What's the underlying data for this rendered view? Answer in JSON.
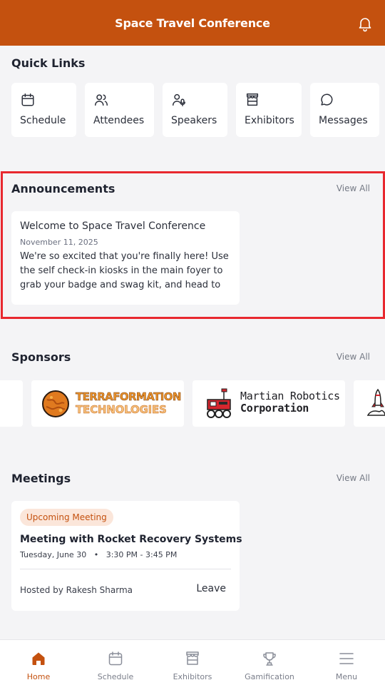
{
  "header": {
    "title": "Space Travel Conference",
    "bell_icon": "bell-icon"
  },
  "quick_links": {
    "title": "Quick Links",
    "items": [
      {
        "label": "Schedule",
        "icon": "calendar-icon"
      },
      {
        "label": "Attendees",
        "icon": "users-icon"
      },
      {
        "label": "Speakers",
        "icon": "speaker-icon"
      },
      {
        "label": "Exhibitors",
        "icon": "booth-icon"
      },
      {
        "label": "Messages",
        "icon": "chat-bubble-icon"
      }
    ]
  },
  "announcements": {
    "title": "Announcements",
    "view_all": "View All",
    "items": [
      {
        "title": "Welcome to Space Travel Conference",
        "date": "November 11, 2025",
        "body": "We're so excited that you're finally here! Use the self check-in kiosks in the main foyer to grab your badge and swag kit, and head to the main stage for the opening keynote."
      }
    ]
  },
  "sponsors": {
    "title": "Sponsors",
    "view_all": "View All",
    "items": [
      {
        "line1": "TERRAFORMATION",
        "line2": "TECHNOLOGIES"
      },
      {
        "line1": "Martian Robotics",
        "line2": "Corporation"
      }
    ]
  },
  "meetings": {
    "title": "Meetings",
    "view_all": "View All",
    "items": [
      {
        "status": "Upcoming Meeting",
        "title": "Meeting with Rocket Recovery Systems",
        "date": "Tuesday, June 30",
        "separator": "•",
        "time": "3:30 PM - 3:45 PM",
        "host": "Hosted by Rakesh Sharma",
        "action": "Leave"
      }
    ]
  },
  "bottom_nav": {
    "items": [
      {
        "label": "Home",
        "icon": "home-icon",
        "active": true
      },
      {
        "label": "Schedule",
        "icon": "calendar-icon",
        "active": false
      },
      {
        "label": "Exhibitors",
        "icon": "booth-icon",
        "active": false
      },
      {
        "label": "Gamification",
        "icon": "trophy-icon",
        "active": false
      },
      {
        "label": "Menu",
        "icon": "hamburger-menu-icon",
        "active": false
      }
    ]
  },
  "colors": {
    "brand": "#c4510f",
    "highlight_border": "#e8282f",
    "background": "#f4f4f6",
    "badge_bg": "#fbe6da"
  }
}
